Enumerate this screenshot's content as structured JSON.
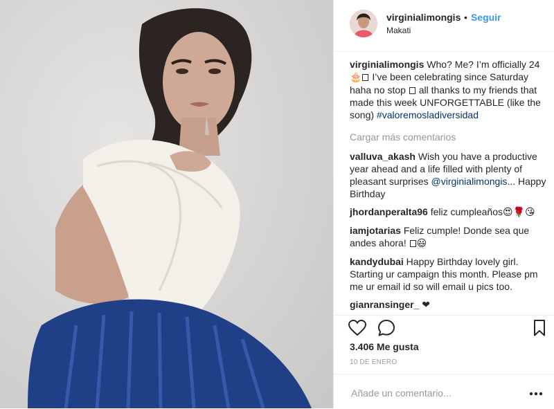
{
  "post": {
    "photo_alt": "Woman in white fuzzy sweater and blue pleated skirt",
    "header": {
      "username": "virginialimongis",
      "separator": "•",
      "follow_label": "Seguir",
      "location": "Makati"
    },
    "caption": {
      "username": "virginialimongis",
      "text_1": " Who? Me? I’m officially 24 ",
      "emoji_1": "🎂",
      "text_2": " I’ve been celebrating since Saturday haha no stop ",
      "text_3": " all thanks to my friends that made this week UNFORGETTABLE (like the song) ",
      "hashtag": "#valoremosladiversidad"
    },
    "load_more_label": "Cargar más comentarios",
    "comments": [
      {
        "username": "valluva_akash",
        "text_1": " Wish you have a productive year ahead and a life filled with plenty of pleasant surprises ",
        "mention": "@virginialimongis",
        "text_2": "... Happy Birthday"
      },
      {
        "username": "jhordanperalta96",
        "text": " feliz cumpleaños",
        "emoji": "😍🌹😘"
      },
      {
        "username": "iamjotarias",
        "text": " Feliz cumple! Donde sea que andes ahora! ",
        "emoji": "😃"
      },
      {
        "username": "kandydubai",
        "text": " Happy Birthday lovely girl. Starting ur campaign this month. Please pm me ur email id so will email u pics too."
      },
      {
        "username": "gianransinger_",
        "text": " ",
        "emoji": "❤"
      }
    ],
    "likes_label": "3.406 Me gusta",
    "date_label": "10 de enero",
    "add_comment_placeholder": "Añade un comentario...",
    "icons": [
      "heart-icon",
      "comment-icon",
      "bookmark-icon",
      "more-options-icon"
    ],
    "colors": {
      "link_blue": "#3897f0",
      "hashtag_blue": "#003569",
      "muted_gray": "#999999",
      "text_dark": "#262626"
    }
  }
}
